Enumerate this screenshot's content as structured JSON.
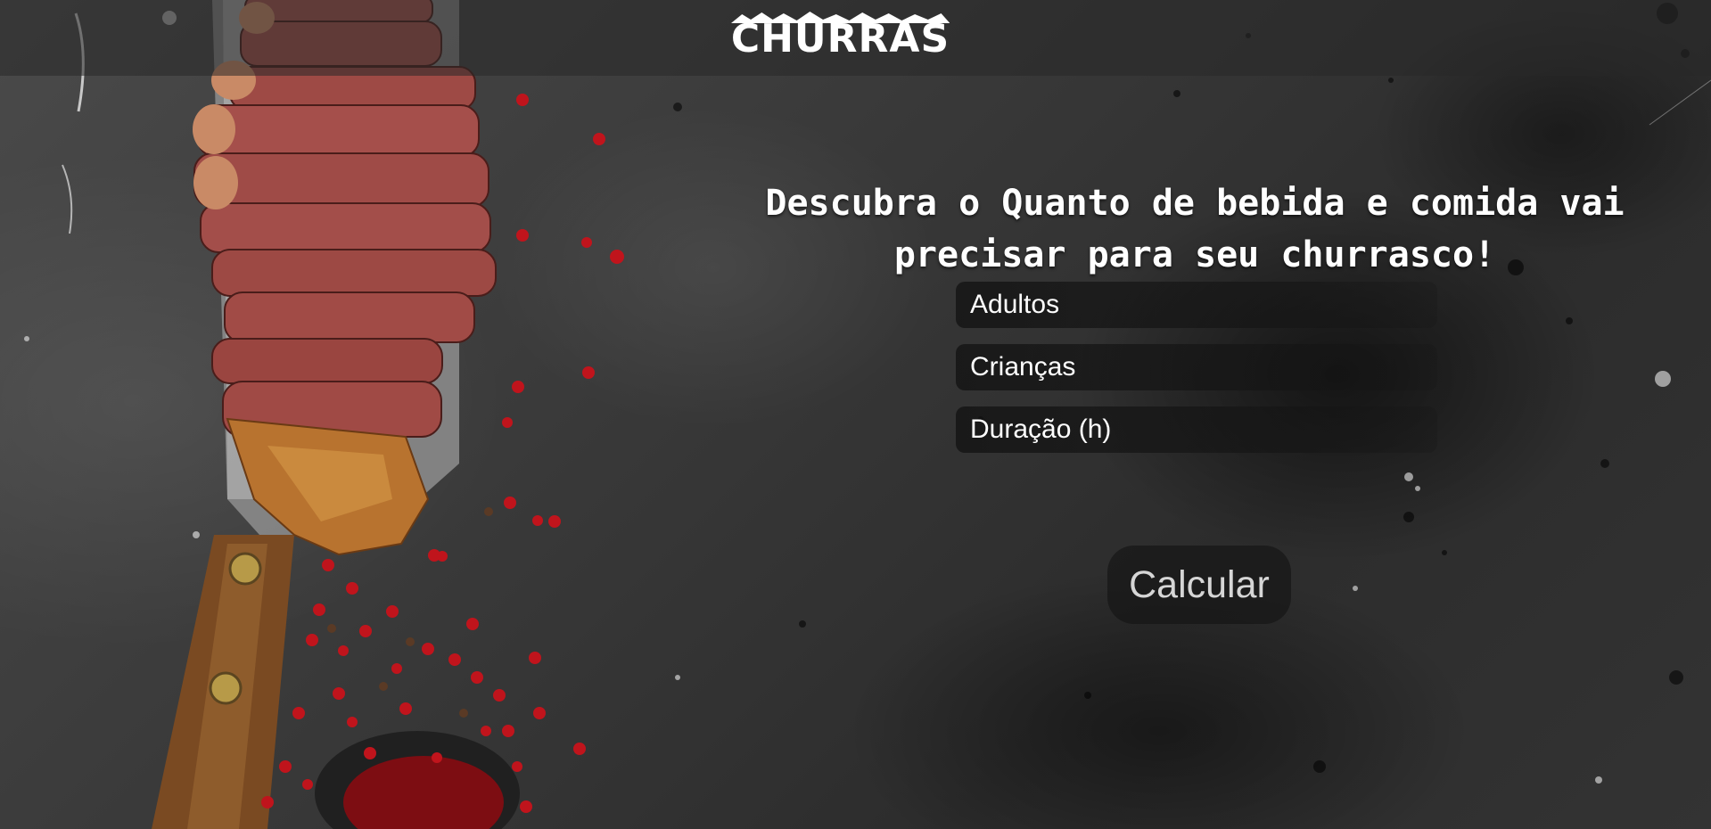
{
  "header": {
    "logo_text": "CHURRAS"
  },
  "main": {
    "headline": "Descubra o Quanto de bebida e comida vai precisar para seu churrasco!",
    "fields": {
      "adults_placeholder": "Adultos",
      "children_placeholder": "Crianças",
      "duration_placeholder": "Duração (h)"
    },
    "calculate_label": "Calcular"
  },
  "colors": {
    "header_bg": "#282828",
    "text": "#ffffff",
    "button_text": "#d6d6d6",
    "meat": "#9c4a45",
    "pepper": "#c0141c",
    "knife_handle": "#7a4a22"
  },
  "icons": {
    "background_photo": "steak-knife-pepper-image"
  }
}
